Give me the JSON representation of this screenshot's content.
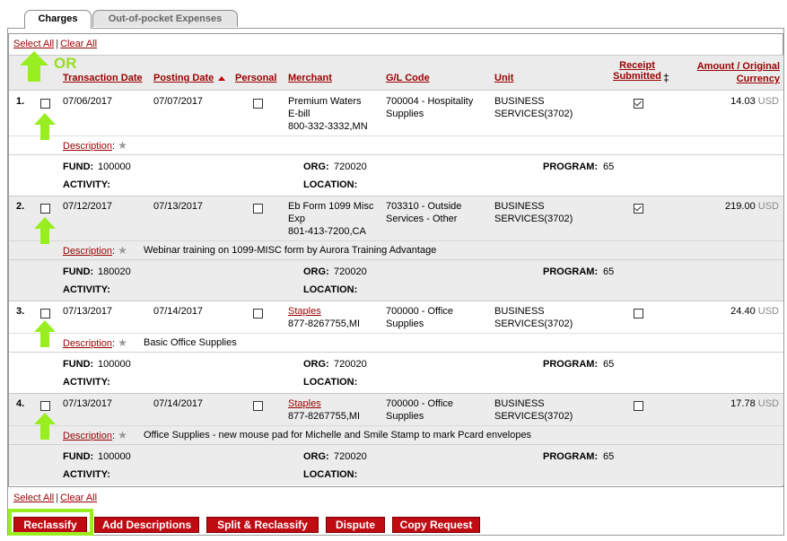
{
  "tabs": [
    {
      "label": "Charges",
      "active": true
    },
    {
      "label": "Out-of-pocket Expenses",
      "active": false
    }
  ],
  "selection": {
    "select_all": "Select All",
    "separator": "|",
    "clear_all": "Clear All"
  },
  "annotation": {
    "or_text": "OR",
    "highlight_color": "#99ee22"
  },
  "columns": {
    "transaction_date": "Transaction Date",
    "posting_date": "Posting Date",
    "personal": "Personal",
    "merchant": "Merchant",
    "gl_code": "G/L Code",
    "unit": "Unit",
    "receipt_submitted_line1": "Receipt",
    "receipt_submitted_line2": "Submitted",
    "receipt_marker": "‡",
    "amount_line1": "Amount / Original",
    "amount_line2": "Currency"
  },
  "labels": {
    "description": "Description",
    "colon": ":",
    "star": "★",
    "fund": "FUND:",
    "org": "ORG:",
    "program": "PROGRAM:",
    "activity": "ACTIVITY:",
    "location": "LOCATION:"
  },
  "rows": [
    {
      "num": "1.",
      "transaction_date": "07/06/2017",
      "posting_date": "07/07/2017",
      "merchant": [
        "Premium Waters",
        "E-bill",
        "800-332-3332,MN"
      ],
      "merchant_link": false,
      "gl_code": [
        "700004 - Hospitality",
        "Supplies"
      ],
      "unit": [
        "BUSINESS",
        "SERVICES(3702)"
      ],
      "receipt_submitted": true,
      "amount": "14.03",
      "currency": "USD",
      "description": "",
      "fund": "100000",
      "org": "720020",
      "program": "65"
    },
    {
      "num": "2.",
      "transaction_date": "07/12/2017",
      "posting_date": "07/13/2017",
      "merchant": [
        "Eb Form 1099 Misc",
        "Exp",
        "801-413-7200,CA"
      ],
      "merchant_link": false,
      "gl_code": [
        "703310 - Outside",
        "Services - Other"
      ],
      "unit": [
        "BUSINESS",
        "SERVICES(3702)"
      ],
      "receipt_submitted": true,
      "amount": "219.00",
      "currency": "USD",
      "description": "Webinar training on 1099-MISC form by Aurora Training Advantage",
      "fund": "180020",
      "org": "720020",
      "program": "65"
    },
    {
      "num": "3.",
      "transaction_date": "07/13/2017",
      "posting_date": "07/14/2017",
      "merchant": [
        "Staples",
        "877-8267755,MI"
      ],
      "merchant_link": true,
      "gl_code": [
        "700000 - Office",
        "Supplies"
      ],
      "unit": [
        "BUSINESS",
        "SERVICES(3702)"
      ],
      "receipt_submitted": false,
      "amount": "24.40",
      "currency": "USD",
      "description": "Basic Office Supplies",
      "fund": "100000",
      "org": "720020",
      "program": "65"
    },
    {
      "num": "4.",
      "transaction_date": "07/13/2017",
      "posting_date": "07/14/2017",
      "merchant": [
        "Staples",
        "877-8267755,MI"
      ],
      "merchant_link": true,
      "gl_code": [
        "700000 - Office",
        "Supplies"
      ],
      "unit": [
        "BUSINESS",
        "SERVICES(3702)"
      ],
      "receipt_submitted": false,
      "amount": "17.78",
      "currency": "USD",
      "description": "Office Supplies - new mouse pad for Michelle and Smile Stamp to mark Pcard envelopes",
      "fund": "100000",
      "org": "720020",
      "program": "65"
    }
  ],
  "buttons": {
    "reclassify": "Reclassify",
    "add_descriptions": "Add Descriptions",
    "split_reclassify": "Split & Reclassify",
    "dispute": "Dispute",
    "copy_request": "Copy Request"
  }
}
